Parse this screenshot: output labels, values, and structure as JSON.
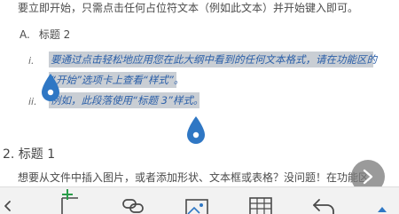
{
  "document": {
    "intro_line": "要立即开始，只需点击任何占位符文本（例如此文本）并开始键入即可。",
    "heading2_marker": "A.",
    "heading2_text": "标题 2",
    "list": [
      {
        "marker": "i.",
        "lines": [
          "要通过点击轻松地应用您在此大纲中看到的任何文本格式，请在功能区的",
          "“开始”选项卡上查看“样式”。"
        ]
      },
      {
        "marker": "ii.",
        "lines": [
          "例如，此段落使用“标题 3”样式。"
        ]
      }
    ],
    "heading1_text": "2. 标题 1",
    "body_line": "想要从文件中插入图片，或者添加形状、文本框或表格？没问题！在功能区的“插"
  },
  "colors": {
    "selection_bg": "#c9ced4",
    "selection_text": "#2b5fa8",
    "handle": "#2f77c4",
    "toolbar_bg": "#f2f2f2",
    "tool_icon": "#4a4a4a",
    "accent": "#2f77c4"
  },
  "toolbar": {
    "icons": [
      "chevron-left-icon",
      "add-text-box-icon",
      "link-icon",
      "image-icon",
      "table-icon",
      "undo-icon",
      "chevron-up-icon"
    ]
  }
}
